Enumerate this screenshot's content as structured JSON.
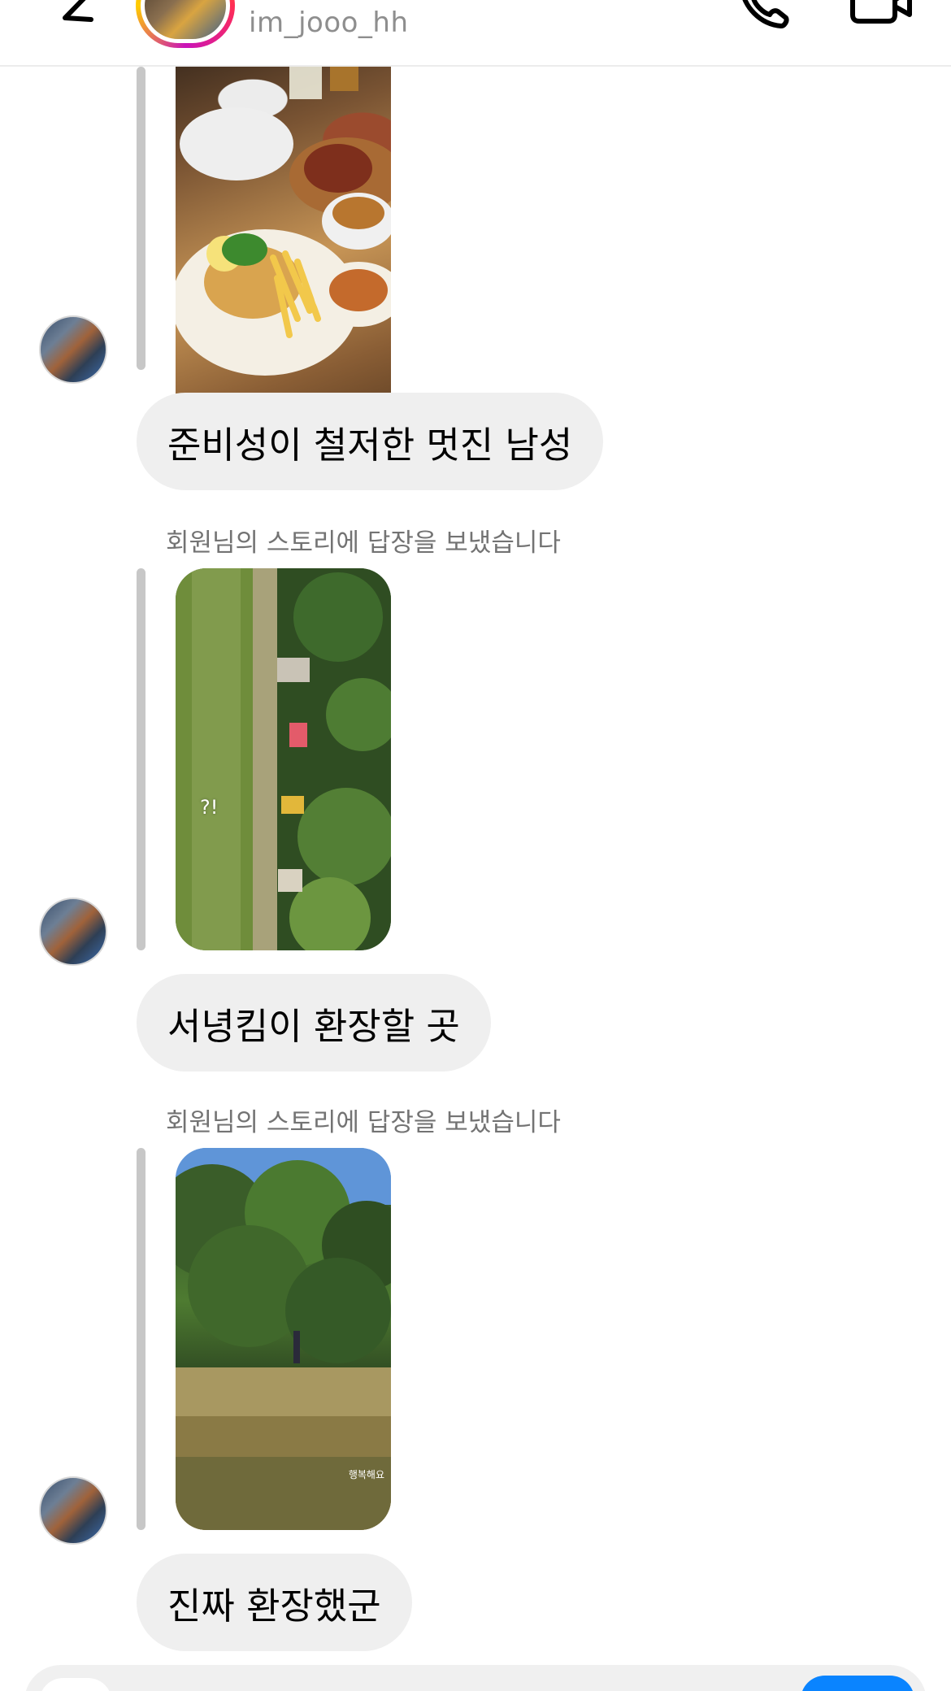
{
  "header": {
    "username": "im_jooo_hh",
    "back_icon": "chevron-left-icon",
    "call_icon": "phone-icon",
    "video_icon": "video-camera-icon"
  },
  "thread": {
    "messages": [
      {
        "type": "story_reply",
        "text": "준비성이 철저한 멋진 남성"
      },
      {
        "type": "story_reply",
        "note": "회원님의 스토리에 답장을 보냈습니다",
        "story_overlay": "?!",
        "text": "서녕킴이 환장할 곳"
      },
      {
        "type": "story_reply",
        "note": "회원님의 스토리에 답장을 보냈습니다",
        "story_overlay": "행복해요",
        "text": "진짜 환장했군"
      }
    ]
  },
  "composer": {
    "camera_icon": "camera-icon",
    "send_color": "#0a84ff"
  },
  "colors": {
    "bubble": "#efefef",
    "note": "#737373",
    "reply_bar": "#c7c7c7",
    "accent": "#0a84ff"
  }
}
